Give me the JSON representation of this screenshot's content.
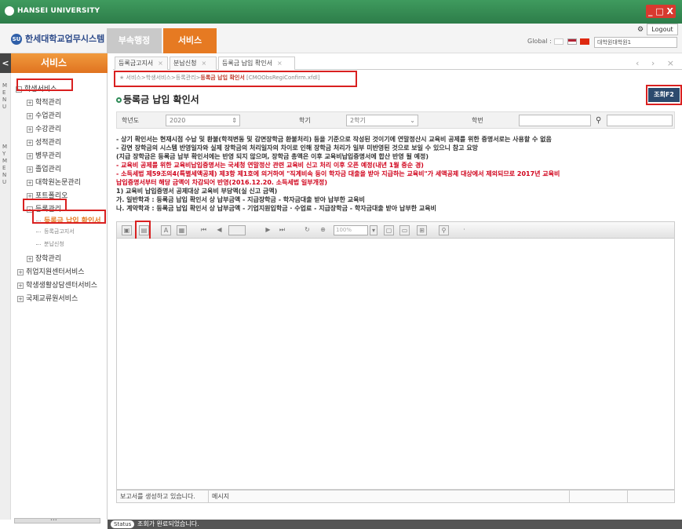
{
  "window": {
    "title": "HANSEI UNIVERSITY",
    "controls": "_ □ X"
  },
  "header": {
    "brand": "한세대학교업무시스템",
    "brand_logo": "hansei-logo",
    "tabs": [
      "부속행정",
      "서비스"
    ],
    "settings_icon": "⚙",
    "logout": "Logout",
    "global_label": "Global :",
    "org_select": "대학원대학원1"
  },
  "sidebar": {
    "title": "서비스",
    "collapse": "<",
    "strip_labels": [
      "MENU",
      "MYMENU"
    ],
    "items": [
      {
        "label": "학생서비스",
        "type": "folder",
        "sign": "-"
      },
      {
        "label": "학적관리",
        "type": "folder",
        "sign": "+"
      },
      {
        "label": "수업관리",
        "type": "folder",
        "sign": "+"
      },
      {
        "label": "수강관리",
        "type": "folder",
        "sign": "+"
      },
      {
        "label": "성적관리",
        "type": "folder",
        "sign": "+"
      },
      {
        "label": "병무관리",
        "type": "folder",
        "sign": "+"
      },
      {
        "label": "졸업관리",
        "type": "folder",
        "sign": "+"
      },
      {
        "label": "대학원논문관리",
        "type": "folder",
        "sign": "+"
      },
      {
        "label": "포트폴리오",
        "type": "folder",
        "sign": "+"
      },
      {
        "label": "등록관리",
        "type": "folder",
        "sign": "-"
      },
      {
        "label": "등록금 납입 확인서",
        "type": "leaf-selected"
      },
      {
        "label": "등록금고지서",
        "type": "leaf"
      },
      {
        "label": "분납신청",
        "type": "leaf"
      },
      {
        "label": "장학관리",
        "type": "folder",
        "sign": "+"
      },
      {
        "label": "취업지원센터서비스",
        "type": "folder",
        "sign": "+"
      },
      {
        "label": "학생생활상담센터서비스",
        "type": "folder",
        "sign": "+"
      },
      {
        "label": "국제교류원서비스",
        "type": "folder",
        "sign": "+"
      }
    ],
    "footer": "•••"
  },
  "doc_tabs": [
    "등록금고지서",
    "분납신청",
    "등록금 납입 확인서"
  ],
  "doc_tab_close": "×",
  "nav_buttons": "‹ › ×",
  "breadcrumb": {
    "path": "서비스>학생서비스>등록관리>",
    "current": "등록금 납입 확인서",
    "code": "[CMOObsRegiConfirm.xfdl]"
  },
  "page_title": "등록금 납입 확인서",
  "query_button": "조회F2",
  "search": {
    "year_label": "학년도",
    "year_value": "2020",
    "term_label": "학기",
    "term_value": "2학기",
    "id_label": "학번",
    "id_value": "",
    "search_icon": "magnifier-icon"
  },
  "notices": [
    {
      "text": "- 상기 확인서는 현재시점 수납 및 환불(학적변동 및 감면장학금 환불처리) 등을 기준으로 작성된 것이기에 연말정산시 교육비 공제를 위한 증명서로는 사용할 수 없음",
      "color": "black"
    },
    {
      "text": "- 감면 장학금의 시스템 반영일자와 실제 장학금의 처리일자의 차이로 인해 장학금 처리가 일부 미반영된 것으로 보일 수 있으니 참고 요망",
      "color": "black"
    },
    {
      "text": "  (지급 장학금은 등록금 납부 확인서에는 반영 되지 않으며, 장학금 총액은 이후 교육비납입증명서에 합산 반영 될 예정)",
      "color": "black"
    },
    {
      "text": "- 교육비 공제를 위한 교육비납입증명서는 국세청 연말정산 관련 교육비 신고 처리 이후 오픈 예정(내년 1월 중순 경)",
      "color": "red"
    },
    {
      "text": "- 소득세법 제59조의4(특별세액공제) 제3항 제1호에 의거하여 \"직계비속 등이 학자금 대출을 받아 지급하는 교육비\"가 세액공제 대상에서 제외되므로 2017년 교육비",
      "color": "red"
    },
    {
      "text": "  납입증명서부터 해당 금액이 차감되어 반영(2016.12.20. 소득세법 일부개정)",
      "color": "red"
    },
    {
      "text": "1) 교육비 납입증명서 공제대상 교육비 부담액(실 신고 금액)",
      "color": "black"
    },
    {
      "text": "가. 일반학과 : 등록금 납입 확인서 상 납부금액 - 지급장학금 - 학자금대출 받아 납부한 교육비",
      "color": "black"
    },
    {
      "text": "나. 계약학과 : 등록금 납입 확인서 상 납부금액 - 기업지원입학금 · 수업료 - 지급장학금 - 학자금대출 받아 납부한 교육비",
      "color": "black"
    }
  ],
  "toolbar": {
    "zoom": "100%",
    "icons": [
      "save-icon",
      "print-icon",
      "text-export-icon",
      "page-setup-icon",
      "first-page-icon",
      "prev-page-icon",
      "page-number-box",
      "next-page-icon",
      "last-page-icon",
      "refresh-icon",
      "zoom-icon",
      "zoom-dropdown",
      "fit-page-icon",
      "fit-width-icon",
      "fit-window-icon",
      "find-icon"
    ]
  },
  "report_status": {
    "message": "보고서를 생성하고 있습니다.",
    "label": "메시지"
  },
  "statusbar": {
    "badge": "Status",
    "message": "조회가 완료되었습니다."
  },
  "colors": {
    "titlebar": "#3f9b5e",
    "accent_orange": "#e67a22",
    "highlight_red": "#d92020",
    "query_button": "#2c4a6e"
  }
}
